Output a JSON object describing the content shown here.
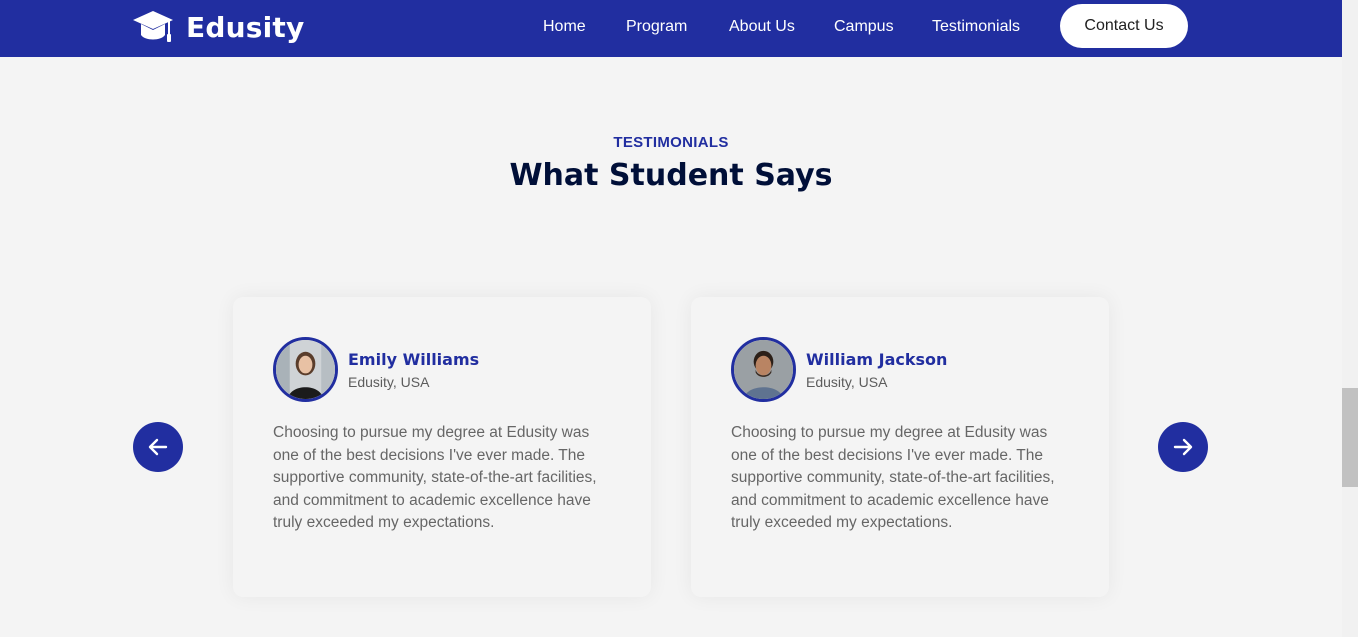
{
  "brand": {
    "name": "Edusity",
    "icon": "graduation-cap-icon"
  },
  "nav": {
    "items": [
      {
        "label": "Home"
      },
      {
        "label": "Program"
      },
      {
        "label": "About Us"
      },
      {
        "label": "Campus"
      },
      {
        "label": "Testimonials"
      }
    ],
    "contact_label": "Contact Us"
  },
  "section": {
    "kicker": "TESTIMONIALS",
    "title": "What Student Says"
  },
  "testimonials": [
    {
      "name": "Emily Williams",
      "location": "Edusity, USA",
      "quote": "Choosing to pursue my degree at Edusity was one of the best decisions I've ever made. The supportive community, state-of-the-art facilities, and commitment to academic excellence have truly exceeded my expectations."
    },
    {
      "name": "William Jackson",
      "location": "Edusity, USA",
      "quote": "Choosing to pursue my degree at Edusity was one of the best decisions I've ever made. The supportive community, state-of-the-art facilities, and commitment to academic excellence have truly exceeded my expectations."
    }
  ],
  "colors": {
    "primary": "#212ea0",
    "title": "#000f38",
    "background": "#f4f4f4",
    "body_text": "#666666"
  }
}
